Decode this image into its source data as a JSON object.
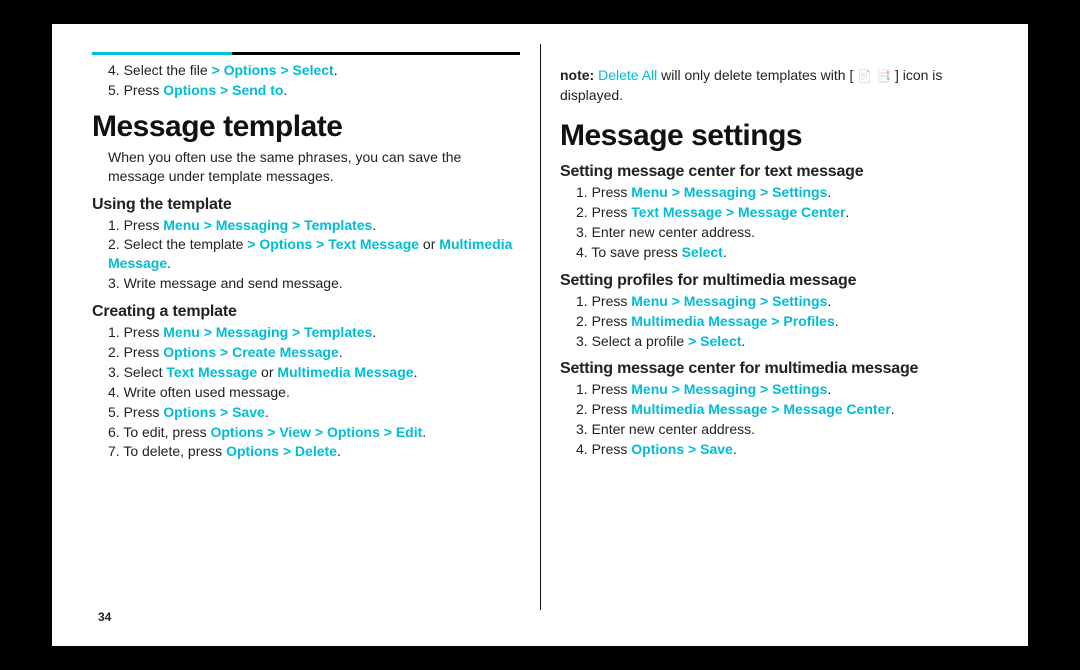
{
  "pageNumber": "34",
  "left": {
    "continuedList": {
      "startAt": 4,
      "items": [
        {
          "segments": [
            {
              "t": "Select the file "
            },
            {
              "t": "> ",
              "cls": "gt"
            },
            {
              "t": "Options",
              "cls": "c"
            },
            {
              "t": " > ",
              "cls": "gt"
            },
            {
              "t": "Select",
              "cls": "c"
            },
            {
              "t": "."
            }
          ]
        },
        {
          "segments": [
            {
              "t": "Press "
            },
            {
              "t": "Options",
              "cls": "c"
            },
            {
              "t": " > ",
              "cls": "gt"
            },
            {
              "t": "Send to",
              "cls": "c"
            },
            {
              "t": "."
            }
          ]
        }
      ]
    },
    "heading": "Message template",
    "intro": "When you often use the same phrases, you can save the message under template messages.",
    "sub1": {
      "title": "Using the template",
      "items": [
        {
          "segments": [
            {
              "t": "Press "
            },
            {
              "t": "Menu",
              "cls": "c"
            },
            {
              "t": " > ",
              "cls": "gt"
            },
            {
              "t": "Messaging",
              "cls": "c"
            },
            {
              "t": " > ",
              "cls": "gt"
            },
            {
              "t": "Templates",
              "cls": "c"
            },
            {
              "t": "."
            }
          ]
        },
        {
          "segments": [
            {
              "t": "Select the template "
            },
            {
              "t": "> ",
              "cls": "gt"
            },
            {
              "t": "Options",
              "cls": "c"
            },
            {
              "t": " > ",
              "cls": "gt"
            },
            {
              "t": "Text Message",
              "cls": "c"
            },
            {
              "t": " or "
            },
            {
              "t": "Multimedia Message",
              "cls": "c"
            },
            {
              "t": "."
            }
          ]
        },
        {
          "segments": [
            {
              "t": "Write message and send message."
            }
          ]
        }
      ]
    },
    "sub2": {
      "title": "Creating a template",
      "items": [
        {
          "segments": [
            {
              "t": "Press "
            },
            {
              "t": "Menu",
              "cls": "c"
            },
            {
              "t": " > ",
              "cls": "gt"
            },
            {
              "t": "Messaging",
              "cls": "c"
            },
            {
              "t": " > ",
              "cls": "gt"
            },
            {
              "t": "Templates",
              "cls": "c"
            },
            {
              "t": "."
            }
          ]
        },
        {
          "segments": [
            {
              "t": "Press "
            },
            {
              "t": "Options",
              "cls": "c"
            },
            {
              "t": " > ",
              "cls": "gt"
            },
            {
              "t": "Create Message",
              "cls": "c"
            },
            {
              "t": "."
            }
          ]
        },
        {
          "segments": [
            {
              "t": "Select "
            },
            {
              "t": "Text Message",
              "cls": "c"
            },
            {
              "t": " or "
            },
            {
              "t": "Multimedia Message",
              "cls": "c"
            },
            {
              "t": "."
            }
          ]
        },
        {
          "segments": [
            {
              "t": "Write often used message."
            }
          ]
        },
        {
          "segments": [
            {
              "t": "Press "
            },
            {
              "t": "Options",
              "cls": "c"
            },
            {
              "t": " > ",
              "cls": "gt"
            },
            {
              "t": "Save",
              "cls": "c"
            },
            {
              "t": "."
            }
          ]
        },
        {
          "segments": [
            {
              "t": "To edit, press "
            },
            {
              "t": "Options",
              "cls": "c"
            },
            {
              "t": " > ",
              "cls": "gt"
            },
            {
              "t": "View",
              "cls": "c"
            },
            {
              "t": " > ",
              "cls": "gt"
            },
            {
              "t": "Options",
              "cls": "c"
            },
            {
              "t": " > ",
              "cls": "gt"
            },
            {
              "t": "Edit",
              "cls": "c"
            },
            {
              "t": "."
            }
          ]
        },
        {
          "segments": [
            {
              "t": "To delete, press "
            },
            {
              "t": "Options",
              "cls": "c"
            },
            {
              "t": " > ",
              "cls": "gt"
            },
            {
              "t": "Delete",
              "cls": "c"
            },
            {
              "t": "."
            }
          ]
        }
      ]
    }
  },
  "right": {
    "note": {
      "lead": "note: ",
      "deleteAll": "Delete All ",
      "rest1": "will only delete templates with [ ",
      "iconA": "📄",
      "iconB": "📑",
      "rest2": " ] icon is displayed."
    },
    "heading": "Message settings",
    "sub1": {
      "title": "Setting message center for text message",
      "items": [
        {
          "segments": [
            {
              "t": "Press "
            },
            {
              "t": "Menu",
              "cls": "c"
            },
            {
              "t": " > ",
              "cls": "gt"
            },
            {
              "t": "Messaging",
              "cls": "c"
            },
            {
              "t": " > ",
              "cls": "gt"
            },
            {
              "t": "Settings",
              "cls": "c"
            },
            {
              "t": "."
            }
          ]
        },
        {
          "segments": [
            {
              "t": "Press "
            },
            {
              "t": "Text Message",
              "cls": "c"
            },
            {
              "t": " > ",
              "cls": "gt"
            },
            {
              "t": "Message Center",
              "cls": "c"
            },
            {
              "t": "."
            }
          ]
        },
        {
          "segments": [
            {
              "t": "Enter new center address."
            }
          ]
        },
        {
          "segments": [
            {
              "t": "To save press "
            },
            {
              "t": "Select",
              "cls": "c"
            },
            {
              "t": "."
            }
          ]
        }
      ]
    },
    "sub2": {
      "title": "Setting profiles for multimedia message",
      "items": [
        {
          "segments": [
            {
              "t": "Press "
            },
            {
              "t": "Menu",
              "cls": "c"
            },
            {
              "t": " > ",
              "cls": "gt"
            },
            {
              "t": "Messaging",
              "cls": "c"
            },
            {
              "t": " > ",
              "cls": "gt"
            },
            {
              "t": "Settings",
              "cls": "c"
            },
            {
              "t": "."
            }
          ]
        },
        {
          "segments": [
            {
              "t": "Press "
            },
            {
              "t": "Multimedia Message",
              "cls": "c"
            },
            {
              "t": " > ",
              "cls": "gt"
            },
            {
              "t": "Profiles",
              "cls": "c"
            },
            {
              "t": "."
            }
          ]
        },
        {
          "segments": [
            {
              "t": "Select a profile "
            },
            {
              "t": "> ",
              "cls": "gt"
            },
            {
              "t": "Select",
              "cls": "c"
            },
            {
              "t": "."
            }
          ]
        }
      ]
    },
    "sub3": {
      "title": "Setting message center for multimedia message",
      "items": [
        {
          "segments": [
            {
              "t": "Press "
            },
            {
              "t": "Menu",
              "cls": "c"
            },
            {
              "t": " > ",
              "cls": "gt"
            },
            {
              "t": "Messaging",
              "cls": "c"
            },
            {
              "t": " > ",
              "cls": "gt"
            },
            {
              "t": "Settings",
              "cls": "c"
            },
            {
              "t": "."
            }
          ]
        },
        {
          "segments": [
            {
              "t": "Press "
            },
            {
              "t": "Multimedia Message",
              "cls": "c"
            },
            {
              "t": " > ",
              "cls": "gt"
            },
            {
              "t": "Message Center",
              "cls": "c"
            },
            {
              "t": "."
            }
          ]
        },
        {
          "segments": [
            {
              "t": "Enter new center address."
            }
          ]
        },
        {
          "segments": [
            {
              "t": "Press "
            },
            {
              "t": "Options",
              "cls": "c"
            },
            {
              "t": " > ",
              "cls": "gt"
            },
            {
              "t": "Save",
              "cls": "c"
            },
            {
              "t": "."
            }
          ]
        }
      ]
    }
  }
}
